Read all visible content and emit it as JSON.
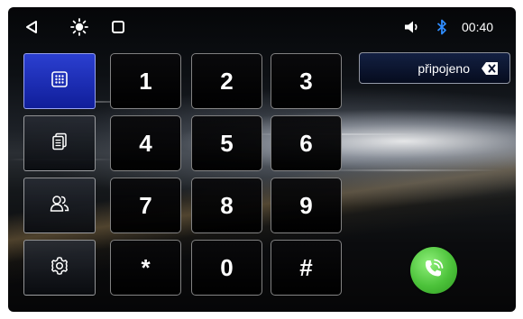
{
  "status_bar": {
    "time": "00:40",
    "icons": [
      "back-icon",
      "brightness-icon",
      "square-icon",
      "volume-icon",
      "bluetooth-icon"
    ]
  },
  "sidebar": {
    "items": [
      {
        "name": "dialpad",
        "icon": "dialpad-icon",
        "active": true
      },
      {
        "name": "call-log",
        "icon": "call-log-icon",
        "active": false
      },
      {
        "name": "contacts",
        "icon": "contacts-icon",
        "active": false
      },
      {
        "name": "settings",
        "icon": "gear-icon",
        "active": false
      }
    ]
  },
  "keypad": {
    "keys": [
      "1",
      "2",
      "3",
      "4",
      "5",
      "6",
      "7",
      "8",
      "9",
      "*",
      "0",
      "#"
    ]
  },
  "display": {
    "text": "připojeno"
  },
  "call_button": {
    "icon": "phone-call-icon",
    "color": "#4cc23a"
  },
  "colors": {
    "accent_active": "#1e30c0",
    "call_green": "#4cc23a"
  }
}
